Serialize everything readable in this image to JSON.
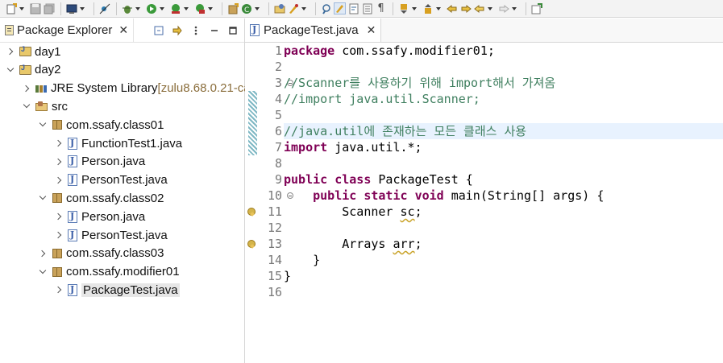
{
  "left": {
    "tab_label": "Package Explorer",
    "close_glyph": "✕",
    "tree": [
      {
        "label": "day1",
        "suffix": "",
        "icon": "project-icon",
        "state": "collapsed",
        "indent": 0
      },
      {
        "label": "day2",
        "suffix": "",
        "icon": "project-icon",
        "state": "expanded",
        "indent": 0
      },
      {
        "label": "JRE System Library",
        "suffix": " [zulu8.68.0.21-ca",
        "icon": "library-icon",
        "state": "collapsed",
        "indent": 1
      },
      {
        "label": "src",
        "suffix": "",
        "icon": "source-folder-icon",
        "state": "expanded",
        "indent": 1
      },
      {
        "label": "com.ssafy.class01",
        "suffix": "",
        "icon": "package-icon",
        "state": "expanded",
        "indent": 2
      },
      {
        "label": "FunctionTest1.java",
        "suffix": "",
        "icon": "java-file-icon",
        "state": "collapsed",
        "indent": 3
      },
      {
        "label": "Person.java",
        "suffix": "",
        "icon": "java-file-icon",
        "state": "collapsed",
        "indent": 3
      },
      {
        "label": "PersonTest.java",
        "suffix": "",
        "icon": "java-file-icon",
        "state": "collapsed",
        "indent": 3
      },
      {
        "label": "com.ssafy.class02",
        "suffix": "",
        "icon": "package-icon",
        "state": "expanded",
        "indent": 2
      },
      {
        "label": "Person.java",
        "suffix": "",
        "icon": "java-file-icon",
        "state": "collapsed",
        "indent": 3
      },
      {
        "label": "PersonTest.java",
        "suffix": "",
        "icon": "java-file-icon",
        "state": "collapsed",
        "indent": 3
      },
      {
        "label": "com.ssafy.class03",
        "suffix": "",
        "icon": "package-icon",
        "state": "collapsed",
        "indent": 2
      },
      {
        "label": "com.ssafy.modifier01",
        "suffix": "",
        "icon": "package-icon",
        "state": "expanded",
        "indent": 2
      },
      {
        "label": "PackageTest.java",
        "suffix": "",
        "icon": "java-file-icon",
        "state": "collapsed",
        "indent": 3,
        "selected": true
      }
    ]
  },
  "editor": {
    "tab_label": "PackageTest.java",
    "close_glyph": "✕",
    "lines": [
      {
        "n": "1",
        "parts": [
          [
            "kw",
            "package"
          ],
          [
            "",
            " com.ssafy.modifier01;"
          ]
        ]
      },
      {
        "n": "2",
        "parts": []
      },
      {
        "n": "3",
        "parts": [
          [
            "cm",
            "//Scanner를 사용하기 위해 import해서 가져옴"
          ]
        ],
        "fold": true
      },
      {
        "n": "4",
        "parts": [
          [
            "cm",
            "//import java.util.Scanner;"
          ]
        ]
      },
      {
        "n": "5",
        "parts": []
      },
      {
        "n": "6",
        "parts": [
          [
            "cm",
            "//java.util에 존재하는 모든 클래스 사용"
          ]
        ],
        "highlight": true
      },
      {
        "n": "7",
        "parts": [
          [
            "kw",
            "import"
          ],
          [
            "",
            " java.util.*;"
          ]
        ]
      },
      {
        "n": "8",
        "parts": []
      },
      {
        "n": "9",
        "parts": [
          [
            "kw",
            "public"
          ],
          [
            "",
            " "
          ],
          [
            "kw",
            "class"
          ],
          [
            "",
            " PackageTest {"
          ]
        ]
      },
      {
        "n": "10",
        "parts": [
          [
            "",
            "    "
          ],
          [
            "kw",
            "public"
          ],
          [
            "",
            " "
          ],
          [
            "kw",
            "static"
          ],
          [
            "",
            " "
          ],
          [
            "kw",
            "void"
          ],
          [
            "",
            " main(String[] args) {"
          ]
        ],
        "fold": true
      },
      {
        "n": "11",
        "parts": [
          [
            "",
            "        Scanner "
          ],
          [
            "sq",
            "sc"
          ],
          [
            "",
            ";"
          ]
        ],
        "warning": true
      },
      {
        "n": "12",
        "parts": []
      },
      {
        "n": "13",
        "parts": [
          [
            "",
            "        Arrays "
          ],
          [
            "sq",
            "arr"
          ],
          [
            "",
            ";"
          ]
        ],
        "warning": true
      },
      {
        "n": "14",
        "parts": [
          [
            "",
            "    }"
          ]
        ]
      },
      {
        "n": "15",
        "parts": [
          [
            "",
            "}"
          ]
        ]
      },
      {
        "n": "16",
        "parts": []
      }
    ]
  },
  "colors": {
    "keyword": "#7f0055",
    "comment": "#3f7f5f",
    "current_line": "#e8f2fe",
    "quick_diff": "#7fb8c4"
  }
}
